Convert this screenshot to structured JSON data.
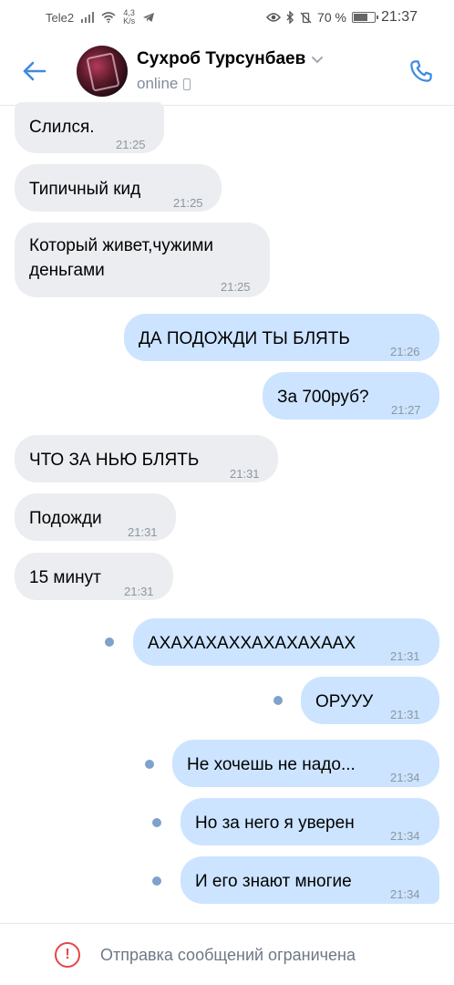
{
  "status_bar": {
    "carrier": "Tele2",
    "speed_value": "4,3",
    "speed_unit": "K/s",
    "battery": "70 %",
    "battery_level": 0.7,
    "time": "21:37"
  },
  "header": {
    "contact_name": "Сухроб Турсунбаев",
    "status": "online"
  },
  "messages": [
    {
      "text": "Слился.",
      "time": "21:25",
      "direction": "in"
    },
    {
      "text": "Типичный кид",
      "time": "21:25",
      "direction": "in"
    },
    {
      "text_line1": "Который живет,чужими",
      "text_line2": "деньгами",
      "time": "21:25",
      "direction": "in"
    },
    {
      "text": "ДА ПОДОЖДИ ТЫ БЛЯТЬ",
      "time": "21:26",
      "direction": "out"
    },
    {
      "text": "За 700руб?",
      "time": "21:27",
      "direction": "out"
    },
    {
      "text": "ЧТО ЗА НЬЮ БЛЯТЬ",
      "time": "21:31",
      "direction": "in"
    },
    {
      "text": "Подожди",
      "time": "21:31",
      "direction": "in"
    },
    {
      "text": "15 минут",
      "time": "21:31",
      "direction": "in"
    },
    {
      "text": "АХАХАХАХХАХАХАХААХ",
      "time": "21:31",
      "direction": "out",
      "unread": true
    },
    {
      "text": "ОРУУУ",
      "time": "21:31",
      "direction": "out",
      "unread": true
    },
    {
      "text": "Не хочешь не надо...",
      "time": "21:34",
      "direction": "out",
      "unread": true
    },
    {
      "text": "Но за него я уверен",
      "time": "21:34",
      "direction": "out",
      "unread": true
    },
    {
      "text": "И его знают многие",
      "time": "21:34",
      "direction": "out",
      "unread": true
    }
  ],
  "footer": {
    "icon": "!",
    "text": "Отправка сообщений ограничена"
  },
  "colors": {
    "accent": "#3f8ae0",
    "incoming_bubble": "#ebedf0",
    "outgoing_bubble": "#cce4ff",
    "unread_dot": "#7da2cc",
    "warning": "#e64646"
  }
}
